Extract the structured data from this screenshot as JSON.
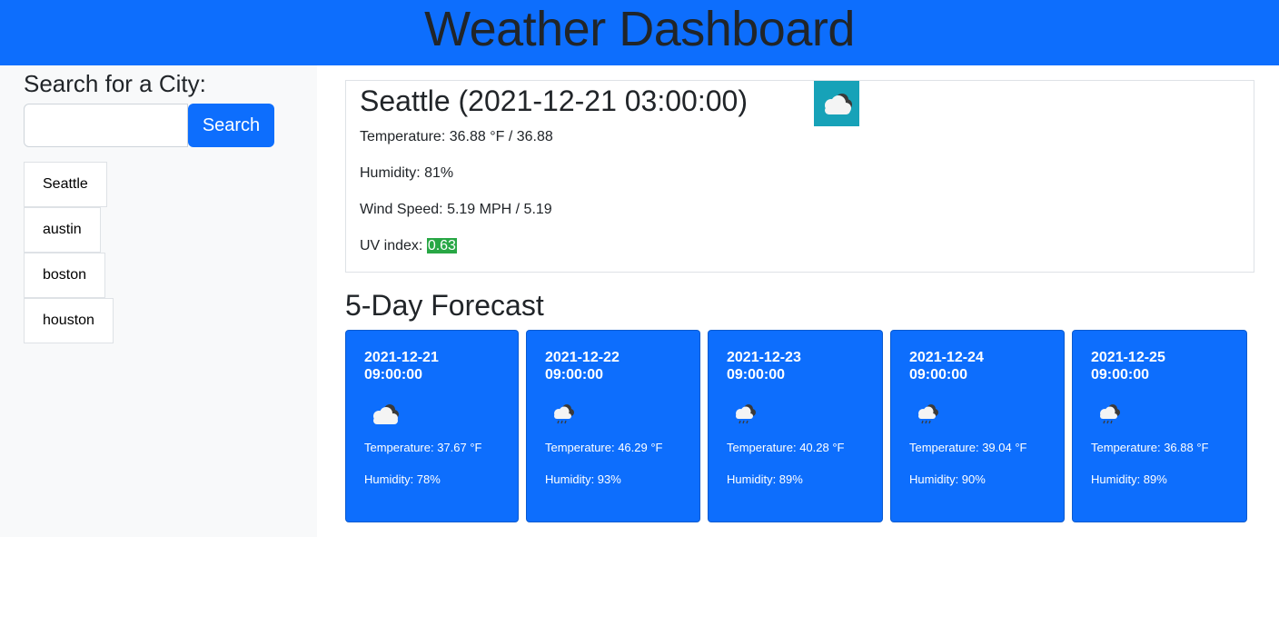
{
  "header": {
    "title": "Weather Dashboard"
  },
  "sidebar": {
    "title": "Search for a City:",
    "search": {
      "value": "",
      "placeholder": ""
    },
    "search_button_label": "Search",
    "history": [
      "Seattle",
      "austin",
      "boston",
      "houston"
    ]
  },
  "current": {
    "city_heading": "Seattle (2021-12-21 03:00:00)",
    "icon": "cloudy-icon",
    "icon_bg_color": "#17a2b8",
    "temperature_label": "Temperature: ",
    "temperature_value": "36.88 °F / 36.88",
    "humidity_label": "Humidity: ",
    "humidity_value": "81%",
    "wind_label": "Wind Speed: ",
    "wind_value": "5.19 MPH / 5.19",
    "uv_label": "UV index: ",
    "uv_value": "0.63",
    "uv_color": "#28a745"
  },
  "forecast": {
    "title": "5-Day Forecast",
    "days": [
      {
        "date": "2021-12-21 09:00:00",
        "icon": "cloudy-icon",
        "temperature": "Temperature: 37.67 °F",
        "humidity": "Humidity: 78%"
      },
      {
        "date": "2021-12-22 09:00:00",
        "icon": "rain-cloud-icon",
        "temperature": "Temperature: 46.29 °F",
        "humidity": "Humidity: 93%"
      },
      {
        "date": "2021-12-23 09:00:00",
        "icon": "rain-cloud-icon",
        "temperature": "Temperature: 40.28 °F",
        "humidity": "Humidity: 89%"
      },
      {
        "date": "2021-12-24 09:00:00",
        "icon": "rain-cloud-icon",
        "temperature": "Temperature: 39.04 °F",
        "humidity": "Humidity: 90%"
      },
      {
        "date": "2021-12-25 09:00:00",
        "icon": "rain-cloud-icon",
        "temperature": "Temperature: 36.88 °F",
        "humidity": "Humidity: 89%"
      }
    ]
  },
  "colors": {
    "primary": "#0d6efd",
    "sidebar_bg": "#f8f9fa"
  }
}
